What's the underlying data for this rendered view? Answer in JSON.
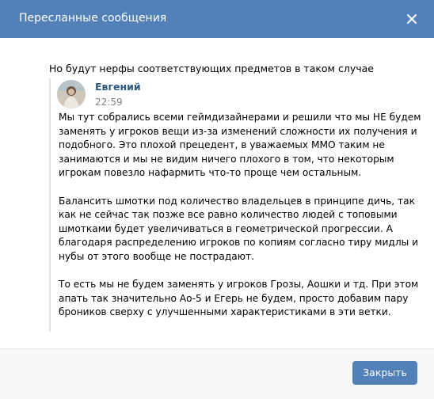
{
  "window": {
    "title": "Пересланные сообщения",
    "close_icon": "close-icon",
    "header_color": "#5181b8"
  },
  "message": {
    "text": "Но будут нерфы соответствующих предметов в таком случае"
  },
  "forwarded": {
    "author": "Евгений",
    "time": "22:59",
    "avatar_icon": "avatar",
    "paragraphs": [
      "Мы тут собрались всеми геймдизайнерами и решили что мы НЕ будем заменять у игроков вещи из-за изменений сложности их получения и подобного. Это плохой прецедент, в уважаемых ММО таким не занимаются и мы не видим ничего плохого в том, что некоторым игрокам повезло нафармить что-то проще чем остальным.",
      "Балансить шмотки под количество владельцев в принципе дичь, так как не сейчас так позже все равно количество людей с топовыми шмотками будет увеличиваться в геометрической прогрессии. А благодаря распределению игроков по копиям согласно тиру мидлы и нубы от этого вообще не пострадают.",
      "То есть мы не будем заменять у игроков Грозы, Аошки и тд. При этом апать так значительно Ао-5 и Егерь не будем, просто добавим пару броников сверху с улучшенными характеристиками в эти ветки."
    ]
  },
  "footer": {
    "close_label": "Закрыть",
    "button_color": "#5181b8"
  }
}
